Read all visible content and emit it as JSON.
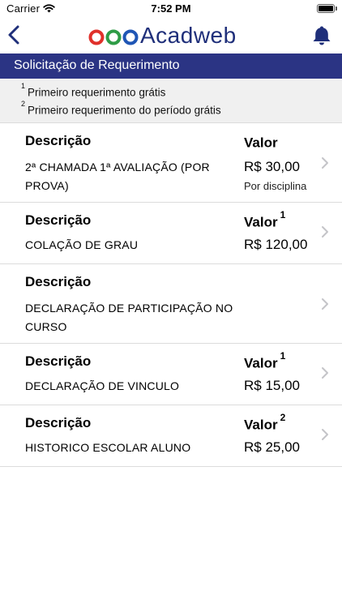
{
  "status_bar": {
    "carrier": "Carrier",
    "time": "7:52 PM"
  },
  "nav": {
    "logo_text": "Acadweb",
    "brand_colors": {
      "ring_red": "#e0302a",
      "ring_green": "#2e9c46",
      "ring_blue": "#1f56b5",
      "text": "#1f2f7a"
    },
    "back_icon": "chevron-left-icon",
    "bell_icon": "bell-icon"
  },
  "section": {
    "title": "Solicitação de Requerimento",
    "color": "#2b3484"
  },
  "notes": [
    {
      "mark": "1",
      "text": "Primeiro requerimento grátis"
    },
    {
      "mark": "2",
      "text": "Primeiro requerimento do período grátis"
    }
  ],
  "list": {
    "desc_header": "Descrição",
    "value_header": "Valor",
    "items": [
      {
        "description": "2ª CHAMADA 1ª AVALIAÇÃO (POR PROVA)",
        "value": "R$ 30,00",
        "value_note": "Por disciplina",
        "value_mark": ""
      },
      {
        "description": "COLAÇÃO DE GRAU",
        "value": "R$ 120,00",
        "value_note": "",
        "value_mark": "1"
      },
      {
        "description": "DECLARAÇÃO DE PARTICIPAÇÃO NO CURSO",
        "value": "",
        "value_note": "",
        "value_mark": ""
      },
      {
        "description": "DECLARAÇÃO DE VINCULO",
        "value": "R$ 15,00",
        "value_note": "",
        "value_mark": "1"
      },
      {
        "description": "HISTORICO ESCOLAR ALUNO",
        "value": "R$ 25,00",
        "value_note": "",
        "value_mark": "2"
      }
    ]
  }
}
